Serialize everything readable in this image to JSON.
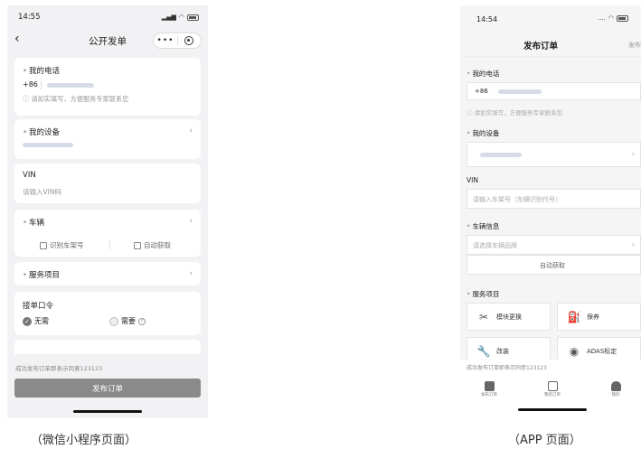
{
  "left_phone": {
    "status_time": "14:55",
    "title": "公开发单",
    "capsule_more": "•••",
    "phone_label": "我的电话",
    "phone_prefix": "+86",
    "phone_hint": "请如实填写，方便服务专家联系您",
    "device_label": "我的设备",
    "vin_label": "VIN",
    "vin_placeholder": "请输入VIN码",
    "vehicle_label": "车辆",
    "scan_plate": "识别车架号",
    "auto_fetch": "自动获取",
    "service_label": "服务项目",
    "code_label": "接单口令",
    "no_need": "无需",
    "need": "需要",
    "agreement": "成功发布订单即表示同意123123",
    "submit": "发布订单",
    "caption": "（微信小程序页面）"
  },
  "right_phone": {
    "status_time": "14:54",
    "title": "发布订单",
    "publish": "发布",
    "phone_label": "我的电话",
    "phone_prefix": "+86",
    "phone_hint": "请如实填写，方便服务专家联系您",
    "device_label": "我的设备",
    "vin_label": "VIN",
    "vin_placeholder": "请输入车架号（车辆识别代号）",
    "vehicle_label": "车辆信息",
    "brand_placeholder": "请选择车辆品牌",
    "auto_fetch": "自动获取",
    "service_label": "服务项目",
    "services": [
      "模块更换",
      "保养",
      "改装",
      "ADAS标定"
    ],
    "agreement": "成功发布订单即表示同意123123",
    "tabs": [
      "发布订单",
      "我的订单",
      "我的"
    ],
    "caption": "（APP 页面）"
  }
}
